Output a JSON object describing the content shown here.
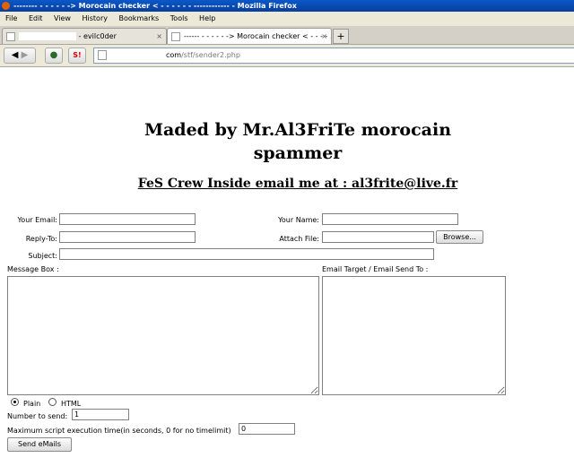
{
  "window": {
    "title": "-------- - - - - - -> Morocain checker < - - - - - - ------------ - Mozilla Firefox"
  },
  "menu": [
    "File",
    "Edit",
    "View",
    "History",
    "Bookmarks",
    "Tools",
    "Help"
  ],
  "tabs": [
    {
      "label": "- evilc0der",
      "active": false
    },
    {
      "label": "------ - - - - - -> Morocain checker < - - - - ...",
      "active": true
    }
  ],
  "url": {
    "host": "com",
    "path": "/stf/sender2.php"
  },
  "page": {
    "title": "Maded by Mr.Al3FriTe morocain spammer",
    "subtitle": "FeS Crew Inside email me at : al3frite@live.fr",
    "form": {
      "your_email_label": "Your Email:",
      "your_email_value": "",
      "your_name_label": "Your Name:",
      "your_name_value": "",
      "reply_to_label": "Reply-To:",
      "reply_to_value": "",
      "attach_file_label": "Attach File:",
      "browse_label": "Browse...",
      "subject_label": "Subject:",
      "subject_value": "",
      "message_box_label": "Message Box :",
      "email_target_label": "Email Target / Email Send To :",
      "format_plain_label": "Plain",
      "format_html_label": "HTML",
      "selected_format": "Plain",
      "number_to_send_label": "Number to send:",
      "number_to_send_value": "1",
      "max_exec_label": "Maximum script execution time(in seconds, 0 for no timelimit)",
      "max_exec_value": "0",
      "send_button_label": "Send eMails"
    }
  }
}
